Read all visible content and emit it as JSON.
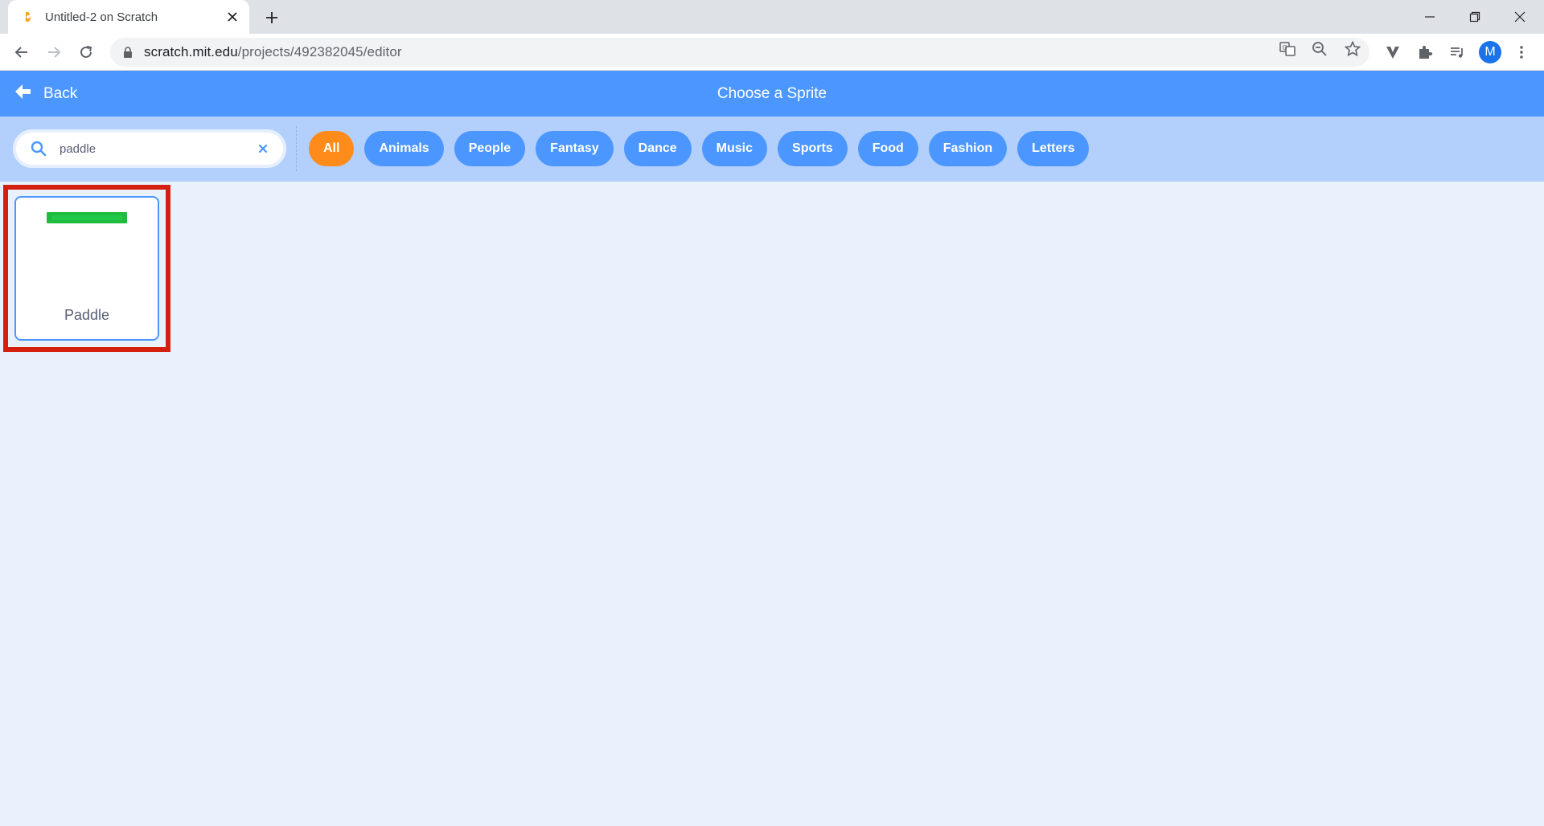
{
  "browser": {
    "tab_title": "Untitled-2 on Scratch",
    "url_host": "scratch.mit.edu",
    "url_path": "/projects/492382045/editor",
    "profile_initial": "M"
  },
  "header": {
    "back_label": "Back",
    "title": "Choose a Sprite"
  },
  "search": {
    "value": "paddle"
  },
  "categories": [
    {
      "label": "All",
      "active": true
    },
    {
      "label": "Animals",
      "active": false
    },
    {
      "label": "People",
      "active": false
    },
    {
      "label": "Fantasy",
      "active": false
    },
    {
      "label": "Dance",
      "active": false
    },
    {
      "label": "Music",
      "active": false
    },
    {
      "label": "Sports",
      "active": false
    },
    {
      "label": "Food",
      "active": false
    },
    {
      "label": "Fashion",
      "active": false
    },
    {
      "label": "Letters",
      "active": false
    }
  ],
  "results": [
    {
      "name": "Paddle"
    }
  ],
  "colors": {
    "header": "#4c97ff",
    "active_pill": "#ff8c1a",
    "highlight": "#d3200f",
    "sprite": "#1fbc3d"
  }
}
